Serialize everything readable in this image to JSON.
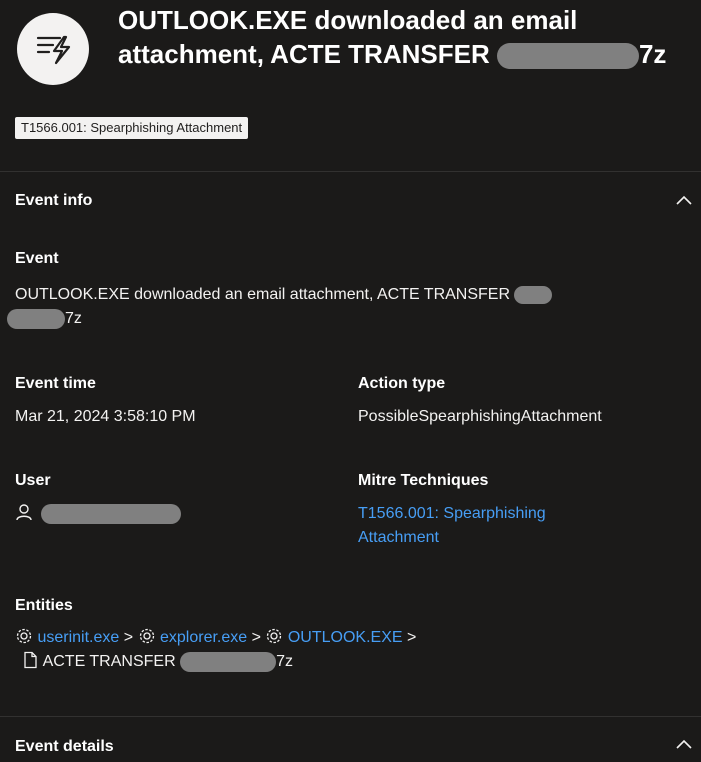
{
  "header": {
    "title_part1": "OUTLOOK.EXE downloaded an email",
    "title_part2": "attachment, ACTE TRANSFER",
    "title_suffix": "7z",
    "icon": "event-lightning-icon"
  },
  "tag": {
    "label": "T1566.001: Spearphishing Attachment"
  },
  "event_info": {
    "section_title": "Event info",
    "event_label": "Event",
    "event_value_line1": "OUTLOOK.EXE downloaded an email attachment, ACTE TRANSFER",
    "event_value_suffix": "7z",
    "event_time_label": "Event time",
    "event_time_value": "Mar 21, 2024 3:58:10 PM",
    "action_type_label": "Action type",
    "action_type_value": "PossibleSpearphishingAttachment",
    "user_label": "User",
    "mitre_label": "Mitre Techniques",
    "mitre_value_line1": "T1566.001: Spearphishing",
    "mitre_value_line2": "Attachment",
    "entities_label": "Entities",
    "entities": [
      {
        "name": "userinit.exe",
        "icon": "gear-icon"
      },
      {
        "name": "explorer.exe",
        "icon": "gear-icon"
      },
      {
        "name": "OUTLOOK.EXE",
        "icon": "gear-icon"
      }
    ],
    "separator": ">",
    "file_name": "ACTE TRANSFER",
    "file_suffix": "7z",
    "file_icon": "file-icon"
  },
  "event_details": {
    "section_title": "Event details"
  },
  "colors": {
    "background": "#1b1a19",
    "link": "#479ef5",
    "redaction": "#808080"
  }
}
